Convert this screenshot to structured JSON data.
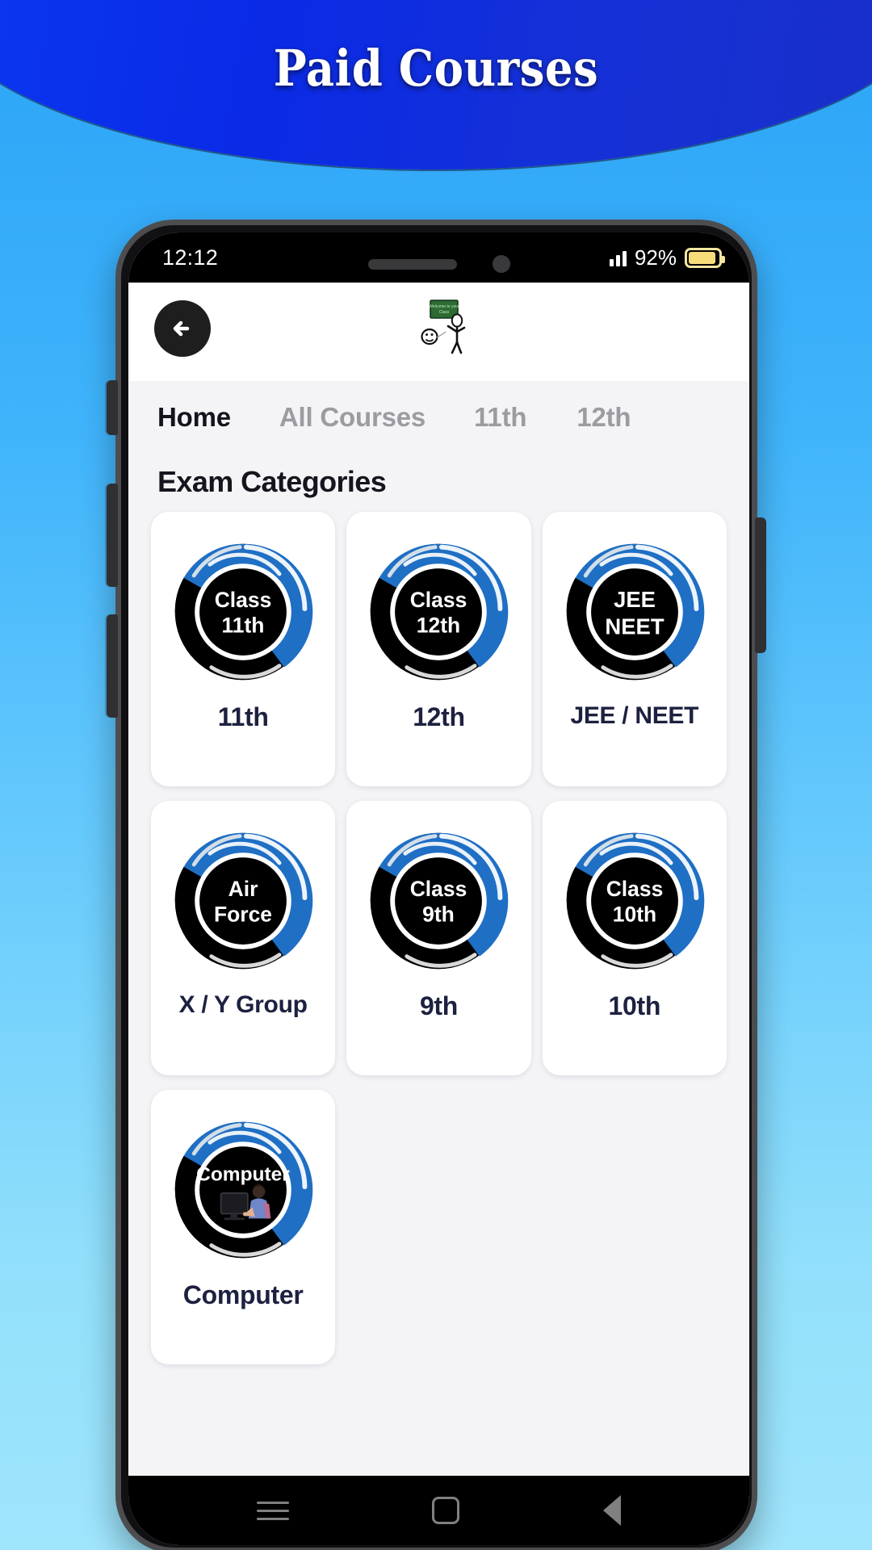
{
  "poster": {
    "title": "Paid Courses",
    "banner_color": "#0a2ae6",
    "background_color": "#2ba4f7"
  },
  "status_bar": {
    "time": "12:12",
    "battery_percent": "92%",
    "battery_level": 92,
    "signal_icon": "signal-bars-icon",
    "battery_icon": "battery-icon",
    "battery_color": "#f6dd7a"
  },
  "app_header": {
    "back_icon": "arrow-left-icon",
    "logo_icon": "teacher-chalkboard-logo"
  },
  "tabs": [
    {
      "label": "Home",
      "active": true
    },
    {
      "label": "All Courses",
      "active": false
    },
    {
      "label": "11th",
      "active": false
    },
    {
      "label": "12th",
      "active": false
    }
  ],
  "section": {
    "title": "Exam Categories"
  },
  "categories": [
    {
      "badge_line1": "Class",
      "badge_line2": "11th",
      "label": "11th",
      "icon": "class-11th-badge-icon"
    },
    {
      "badge_line1": "Class",
      "badge_line2": "12th",
      "label": "12th",
      "icon": "class-12th-badge-icon"
    },
    {
      "badge_line1": "JEE",
      "badge_line2": "NEET",
      "label": "JEE / NEET",
      "icon": "jee-neet-badge-icon"
    },
    {
      "badge_line1": "Air",
      "badge_line2": "Force",
      "label": "X / Y Group",
      "icon": "air-force-badge-icon"
    },
    {
      "badge_line1": "Class",
      "badge_line2": "9th",
      "label": "9th",
      "icon": "class-9th-badge-icon"
    },
    {
      "badge_line1": "Class",
      "badge_line2": "10th",
      "label": "10th",
      "icon": "class-10th-badge-icon"
    },
    {
      "badge_line1": "Computer",
      "badge_line2": "",
      "label": "Computer",
      "icon": "computer-badge-icon"
    }
  ],
  "theme": {
    "badge_blue": "#1f6fc4",
    "badge_black": "#000000",
    "card_background": "#ffffff",
    "screen_background": "#f4f4f6",
    "label_color": "#1d2140",
    "tab_active_color": "#14141c",
    "tab_inactive_color": "#9b9ba1"
  },
  "nav_bar": {
    "recents_icon": "menu-icon",
    "home_icon": "home-square-icon",
    "back_icon": "back-triangle-icon"
  }
}
